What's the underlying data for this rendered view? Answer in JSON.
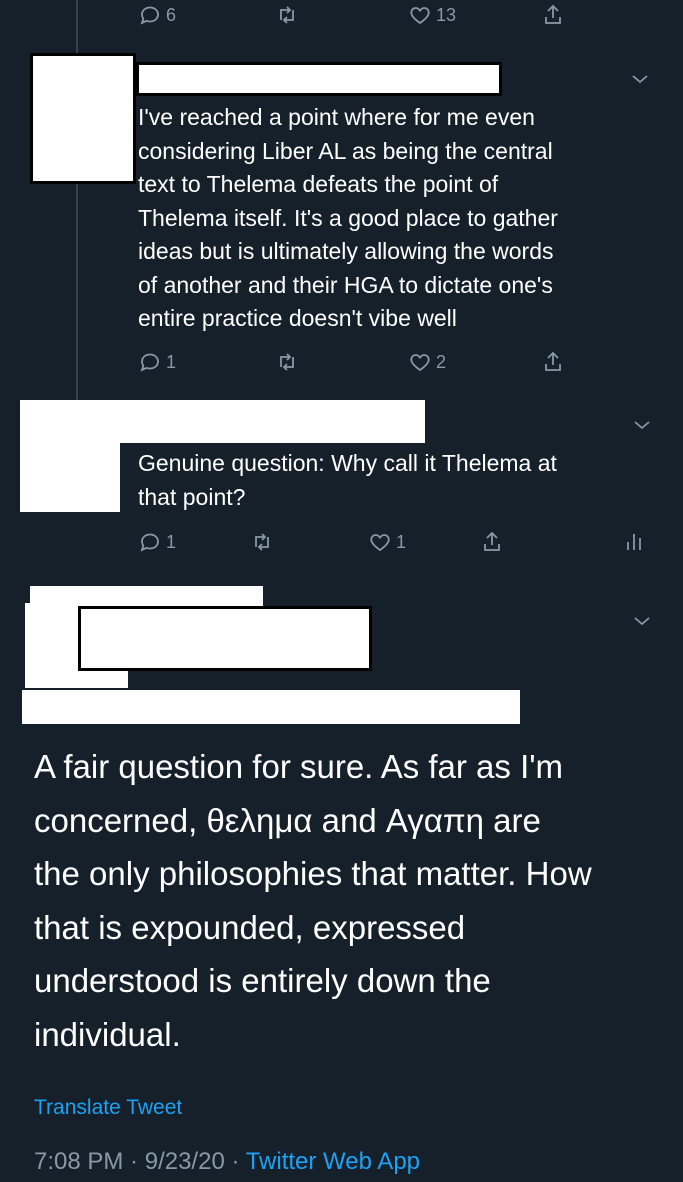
{
  "tweets": [
    {
      "id": "tweet1",
      "counts": {
        "reply": "6",
        "retweet": "",
        "like": "13"
      }
    },
    {
      "id": "tweet2",
      "text": "I've reached a point where for me even considering Liber AL as being the central text to Thelema defeats the point of Thelema itself. It's a good place to gather ideas but is ultimately allowing the words of another and their HGA to dictate one's entire practice doesn't vibe well",
      "lines": [
        "I've reached a point where for me even",
        "considering Liber AL as being the central",
        "text to Thelema defeats the point of",
        "Thelema itself. It's a good place to gather",
        "ideas but is ultimately allowing the words",
        "of another and their HGA to dictate one's",
        "entire practice doesn't vibe well"
      ],
      "counts": {
        "reply": "1",
        "retweet": "",
        "like": "2"
      }
    },
    {
      "id": "tweet3",
      "lines": [
        "Genuine question: Why call it Thelema at",
        "that point?"
      ],
      "counts": {
        "reply": "1",
        "retweet": "",
        "like": "1"
      }
    }
  ],
  "main_tweet": {
    "lines": [
      "A fair question for sure. As far as I'm",
      "concerned, θελημα and Αγαπη are",
      "the only philosophies that matter. How",
      "that is expounded, expressed",
      "understood is entirely down the",
      "individual."
    ],
    "translate_label": "Translate Tweet",
    "time": "7:08 PM",
    "sep1": " · ",
    "date": "9/23/20",
    "sep2": " · ",
    "source": "Twitter Web App"
  },
  "colors": {
    "background": "#15202b",
    "text": "#ffffff",
    "muted": "#8899a6",
    "link": "#1da1f2"
  },
  "icons": [
    "reply-icon",
    "retweet-icon",
    "like-icon",
    "share-icon",
    "chevron-down-icon",
    "analytics-icon"
  ]
}
